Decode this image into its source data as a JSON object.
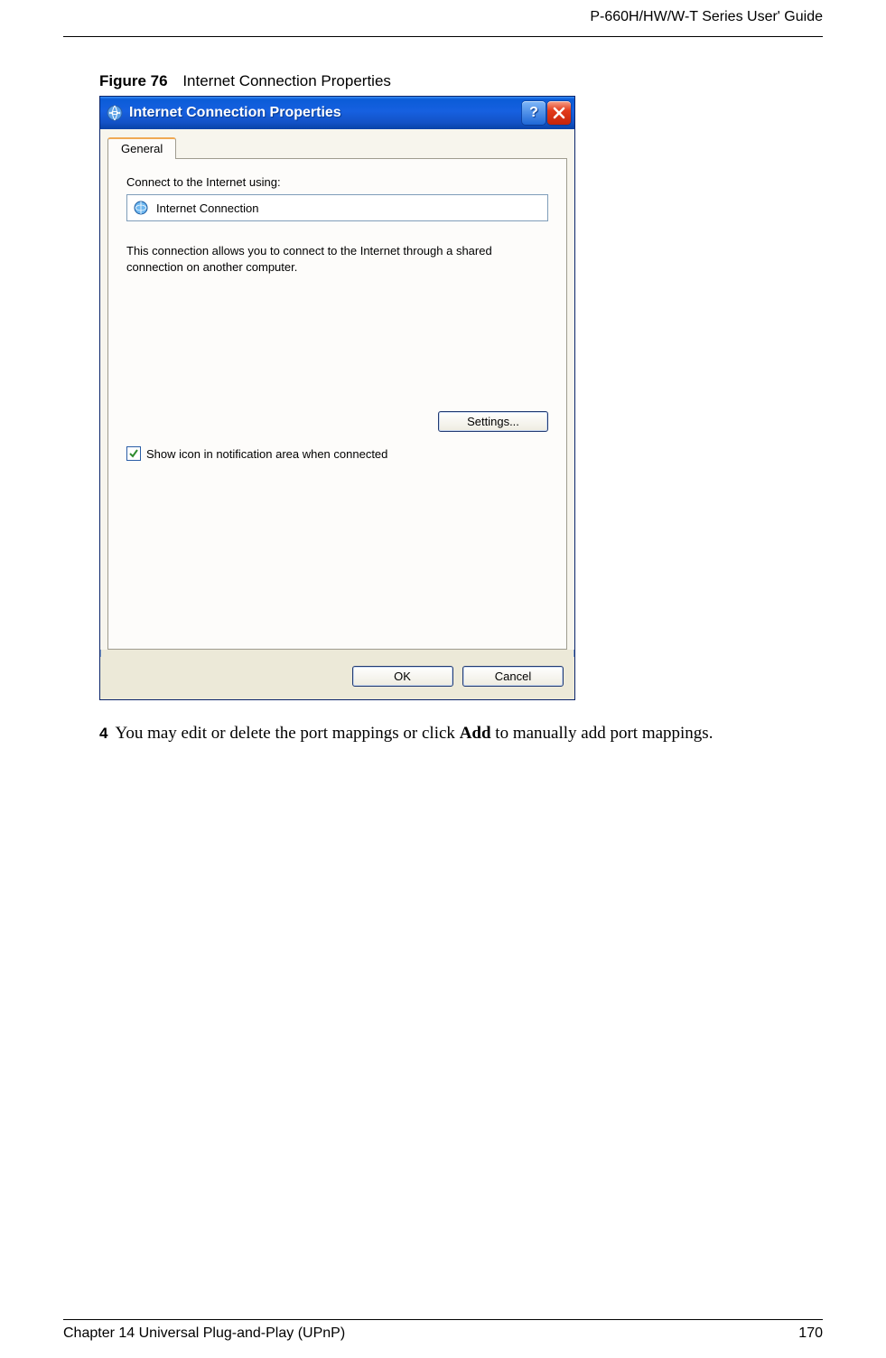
{
  "header": {
    "guide_title": "P-660H/HW/W-T Series User' Guide"
  },
  "figure": {
    "number": "Figure 76",
    "title": "Internet Connection Properties"
  },
  "dialog": {
    "title": "Internet Connection Properties",
    "tab_label": "General",
    "connect_label": "Connect to the Internet using:",
    "connection_name": "Internet Connection",
    "description": "This connection allows you to connect to the Internet through a shared connection on another computer.",
    "settings_button": "Settings...",
    "checkbox_label": "Show icon in notification area when connected",
    "ok_button": "OK",
    "cancel_button": "Cancel"
  },
  "step": {
    "number": "4",
    "text_before": "You may edit or delete the port mappings or click ",
    "bold": "Add",
    "text_after": " to manually add port mappings."
  },
  "footer": {
    "chapter": "Chapter 14 Universal Plug-and-Play (UPnP)",
    "page": "170"
  }
}
